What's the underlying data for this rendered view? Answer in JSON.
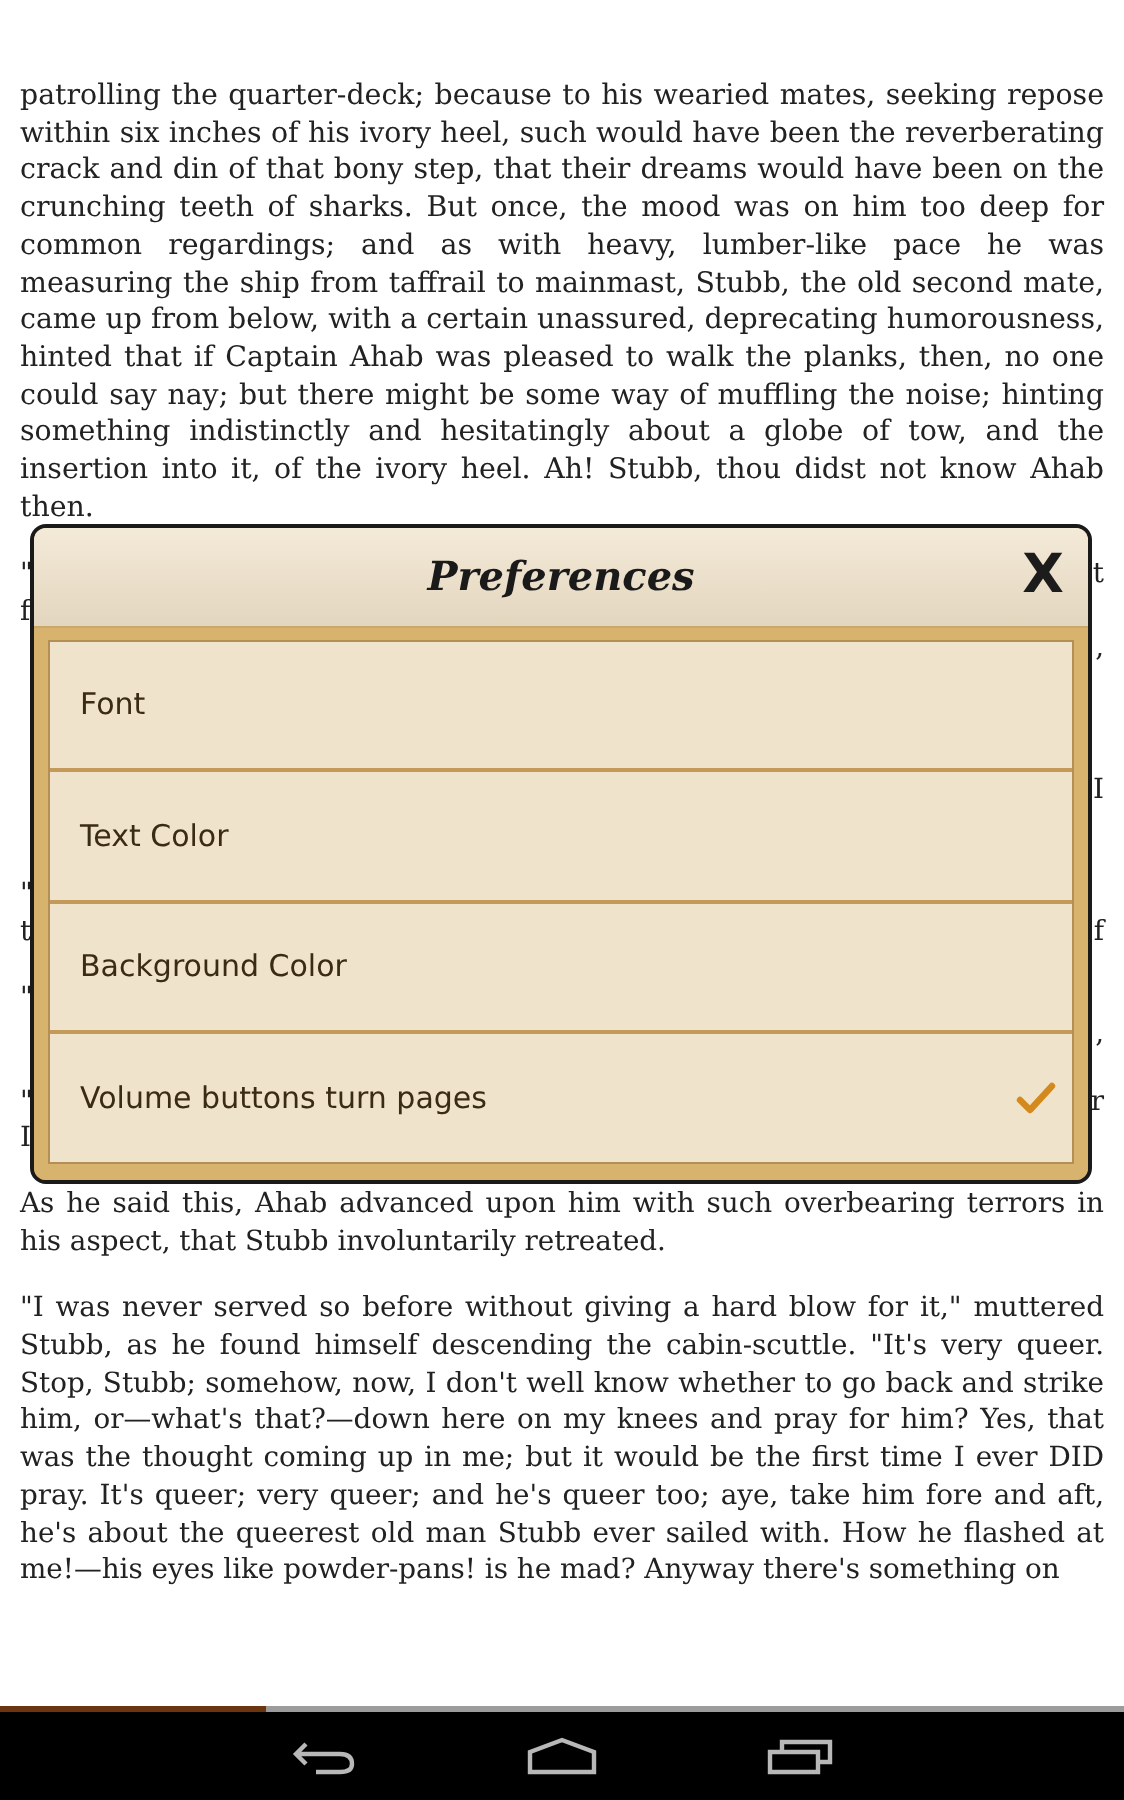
{
  "book_text_before": "patrolling the quarter-deck; because to his wearied mates, seeking repose within six inches of his ivory heel, such would have been the reverberating crack and din of that bony step, that their dreams would have been on the crunching teeth of sharks. But once, the mood was on him too deep for common regardings; and as with heavy, lumber-like pace he was measuring the ship from taffrail to mainmast, Stubb, the old second mate, came up from below, with a certain unassured, deprecating humorousness, hinted that if Captain Ahab was pleased to walk the planks, then, no one could say nay; but there might be some way of muffling the noise; hinting something indistinctly and hesitatingly about a globe of tow, and the insertion into it, of the ivory heel. Ah! Stubb, thou didst not know Ahab then.",
  "hidden_paragraphs": [
    [
      {
        "left": "\"",
        "right": "t"
      },
      {
        "left": "f"
      },
      {
        "right": ","
      }
    ],
    [
      {
        "right": "I"
      }
    ],
    [
      {
        "left": "\""
      },
      {
        "left": "t",
        "right": "f"
      }
    ],
    [
      {
        "left": "\""
      },
      {
        "right": ","
      }
    ],
    [
      {
        "left": "\"",
        "right": "r"
      },
      {
        "left": "I"
      }
    ]
  ],
  "book_text_after": [
    "As he said this, Ahab advanced upon him with such overbearing terrors in his aspect, that Stubb involuntarily retreated.",
    "\"I was never served so before without giving a hard blow for it,\" muttered Stubb, as he found himself descending the cabin-scuttle. \"It's very queer. Stop, Stubb; somehow, now, I don't well know whether to go back and strike him, or—what's that?—down here on my knees and pray for him? Yes, that was the thought coming up in me; but it would be the first time I ever DID pray. It's queer; very queer; and he's queer too; aye, take him fore and aft, he's about the queerest old man Stubb ever sailed with. How he flashed at me!—his eyes like powder-pans! is he mad? Anyway there's something on"
  ],
  "dialog": {
    "title": "Preferences",
    "close": "X",
    "items": [
      {
        "label": "Font",
        "kind": "link"
      },
      {
        "label": "Text Color",
        "kind": "link"
      },
      {
        "label": "Background Color",
        "kind": "link"
      },
      {
        "label": "Volume buttons turn pages",
        "kind": "toggle",
        "checked": true
      }
    ]
  },
  "reading_progress": {
    "level": 0.237
  }
}
